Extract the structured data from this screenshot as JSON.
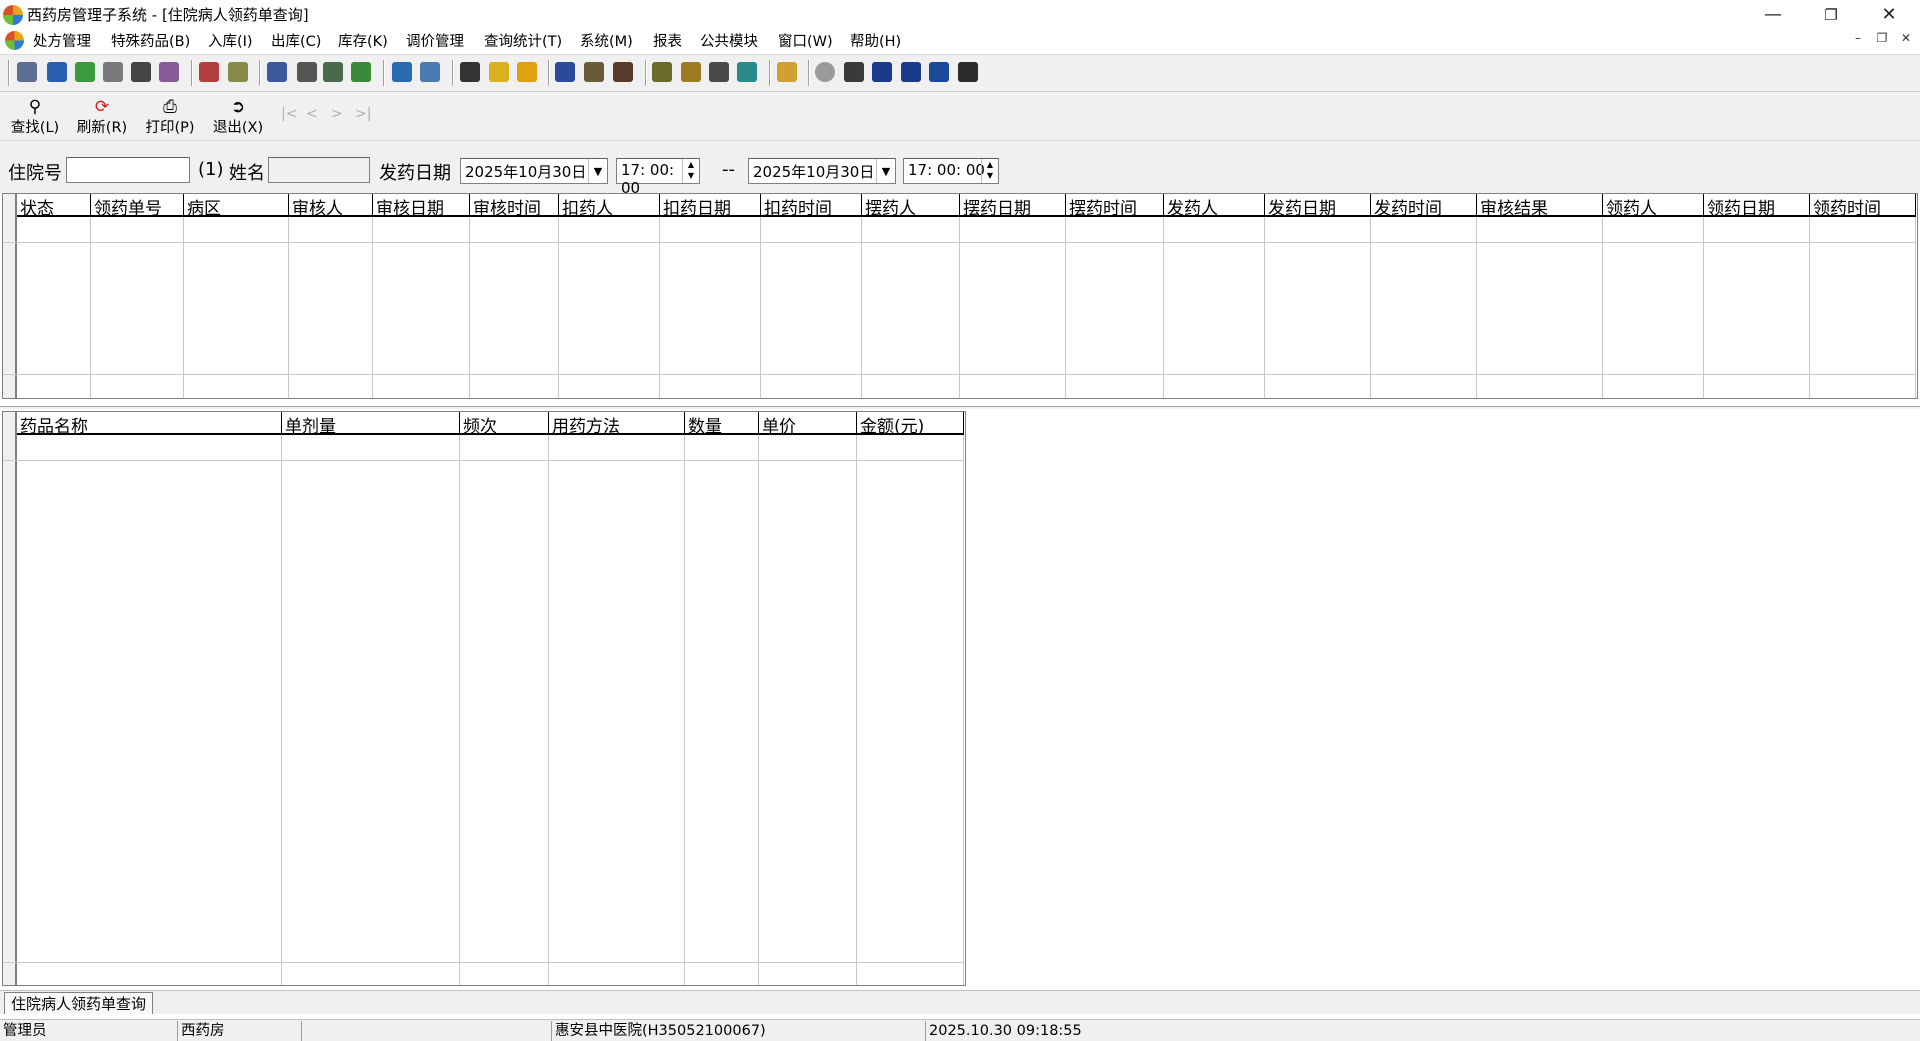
{
  "window": {
    "title": "西药房管理子系统 - [住院病人领药单查询]"
  },
  "menu": [
    "处方管理",
    "特殊药品(B)",
    "入库(I)",
    "出库(C)",
    "库存(K)",
    "调价管理",
    "查询统计(T)",
    "系统(M)",
    "报表",
    "公共模块",
    "窗口(W)",
    "帮助(H)"
  ],
  "toolbar2": {
    "find": "查找(L)",
    "refresh": "刷新(R)",
    "print": "打印(P)",
    "exit": "退出(X)"
  },
  "search": {
    "inpatient_label": "住院号",
    "inpatient_value": "",
    "hint": "(1)",
    "name_label": "姓名",
    "name_value": "",
    "date_label": "发药日期",
    "from_date": "2025年10月30日",
    "from_time": "17: 00: 00",
    "sep": "--",
    "to_date": "2025年10月30日",
    "to_time": "17: 00: 00"
  },
  "upper_grid": {
    "columns": [
      "状态",
      "领药单号",
      "病区",
      "审核人",
      "审核日期",
      "审核时间",
      "扣药人",
      "扣药日期",
      "扣药时间",
      "摆药人",
      "摆药日期",
      "摆药时间",
      "发药人",
      "发药日期",
      "发药时间",
      "审核结果",
      "领药人",
      "领药日期",
      "领药时间"
    ]
  },
  "lower_grid": {
    "columns": [
      "药品名称",
      "单剂量",
      "频次",
      "用药方法",
      "数量",
      "单价",
      "金额(元)"
    ]
  },
  "tab": {
    "label": "住院病人领药单查询"
  },
  "status": {
    "user": "管理员",
    "dept": "西药房",
    "empty": "",
    "hospital": "惠安县中医院(H35052100067)",
    "datetime": "2025.10.30 09:18:55"
  },
  "colors": {
    "toolbar_bg": "#f0f0f0",
    "grid_line": "#c8c8c8",
    "header_border": "#000000"
  }
}
